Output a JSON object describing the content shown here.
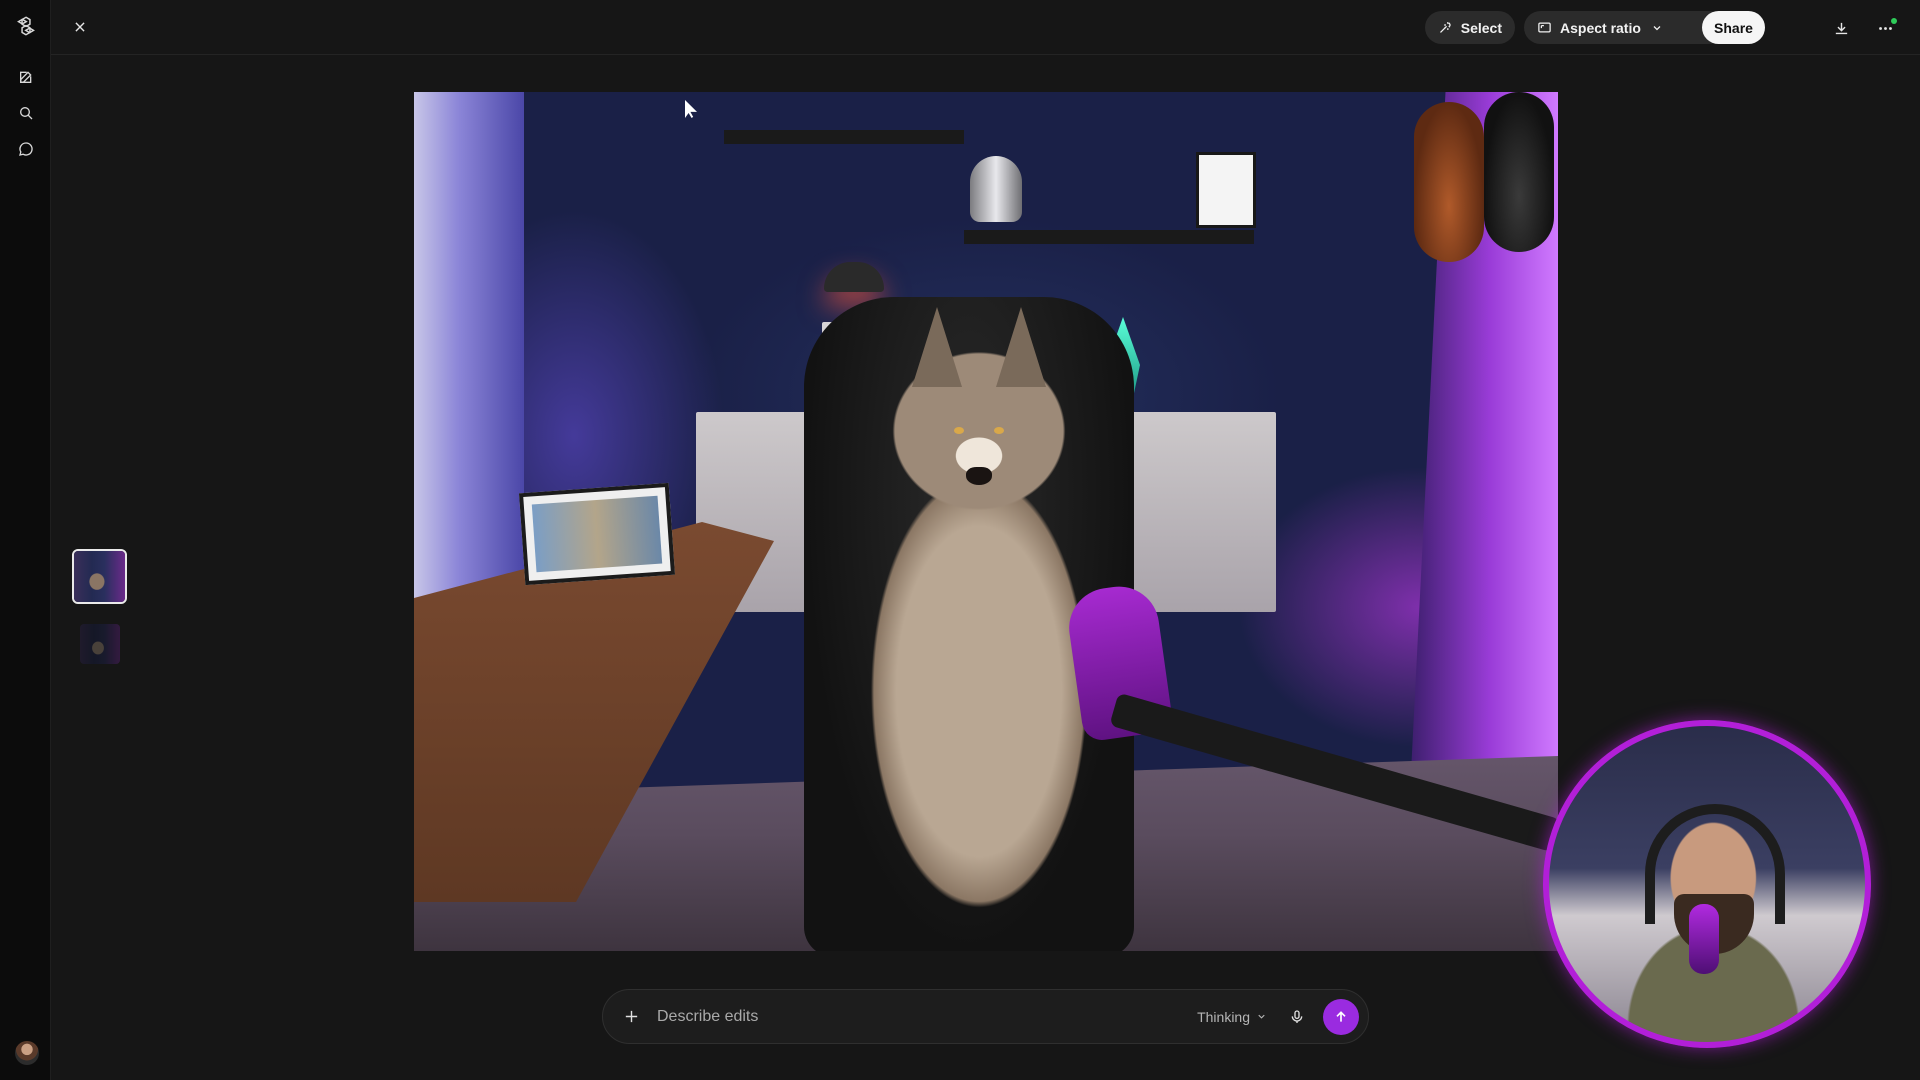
{
  "rail": {
    "logo_icon": "openai-logo-icon",
    "items": [
      {
        "name": "new-chat",
        "icon": "edit-icon"
      },
      {
        "name": "search",
        "icon": "search-icon"
      },
      {
        "name": "chats",
        "icon": "chat-bubble-icon"
      }
    ]
  },
  "toolbar": {
    "close_icon": "close-icon",
    "select_label": "Select",
    "aspect_label": "Aspect ratio",
    "share_label": "Share",
    "download_icon": "download-icon",
    "more_icon": "more-horizontal-icon"
  },
  "thumbnails": [
    {
      "name": "image-version-1",
      "selected": true
    },
    {
      "name": "image-version-2",
      "selected": false
    }
  ],
  "composer": {
    "placeholder": "Describe edits",
    "mode_label": "Thinking",
    "add_icon": "plus-icon",
    "mic_icon": "microphone-icon",
    "send_icon": "arrow-up-icon"
  },
  "colors": {
    "accent": "#9a2be0",
    "webcam_ring": "#b21fd8",
    "status_online": "#2ecc59"
  }
}
